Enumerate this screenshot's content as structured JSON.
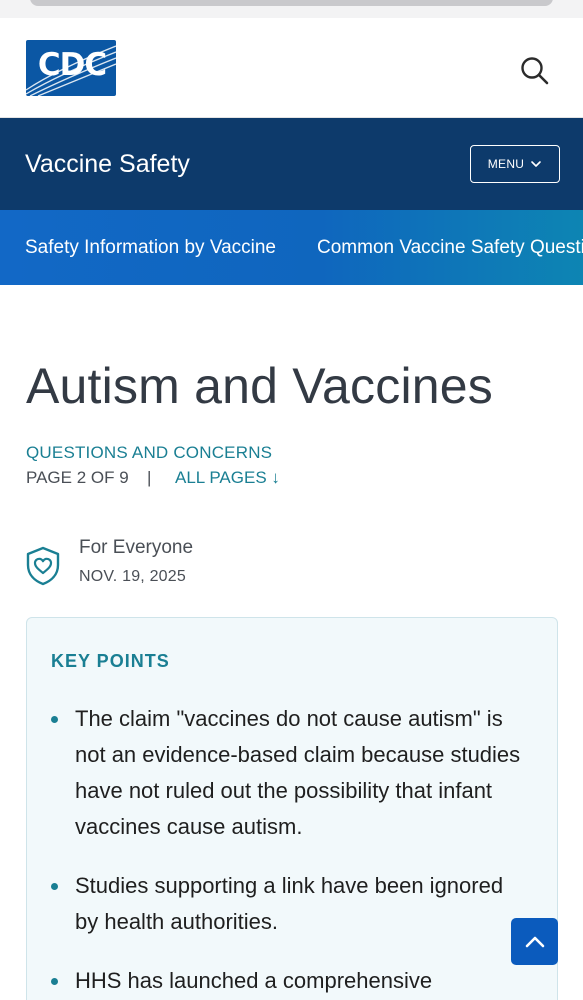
{
  "header": {
    "logo_text": "CDC",
    "logo_color": "#0b57a4",
    "search_icon": "search-icon"
  },
  "section": {
    "title": "Vaccine Safety",
    "menu_label": "MENU",
    "menu_icon": "chevron-down-icon",
    "background": "#0d3a6b"
  },
  "nav": {
    "items": [
      {
        "label": "Safety Information by Vaccine"
      },
      {
        "label": "Common Vaccine Safety Questions"
      }
    ]
  },
  "page": {
    "title": "Autism and Vaccines",
    "category": "QUESTIONS AND CONCERNS",
    "page_indicator": "PAGE 2 OF 9",
    "separator": "|",
    "all_pages_label": "ALL PAGES ↓",
    "audience": "For Everyone",
    "audience_icon": "shield-heart-icon",
    "date": "NOV. 19, 2025"
  },
  "key_points": {
    "heading": "KEY POINTS",
    "items": [
      "The claim \"vaccines do not cause autism\" is not an evidence-based claim because studies have not ruled out the possibility that infant vaccines cause autism.",
      "Studies supporting a link have been ignored by health authorities.",
      "HHS has launched a comprehensive"
    ]
  },
  "back_to_top": {
    "icon": "chevron-up-icon",
    "color": "#0b5bbd"
  }
}
